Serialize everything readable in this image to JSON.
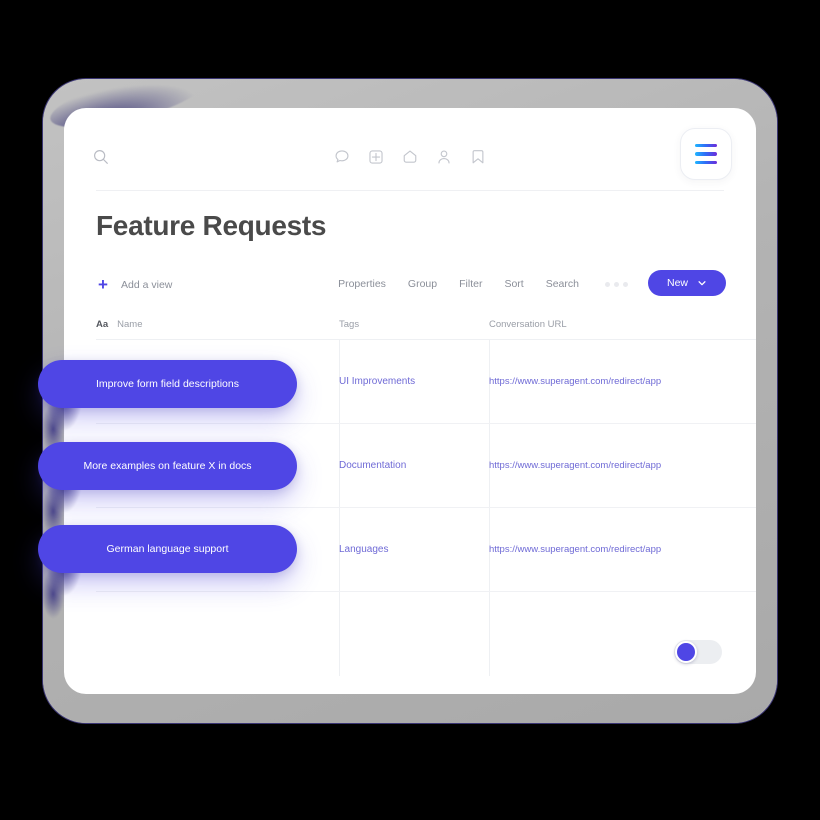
{
  "header": {
    "search_icon": "search-icon",
    "nav_icons": [
      {
        "name": "chat-bubble-icon",
        "label": "Messages"
      },
      {
        "name": "grid-plus-icon",
        "label": "Apps"
      },
      {
        "name": "home-icon",
        "label": "Home"
      },
      {
        "name": "user-icon",
        "label": "Profile"
      },
      {
        "name": "bookmark-icon",
        "label": "Saved"
      }
    ],
    "menu_icon": "hamburger-menu-icon",
    "menu_gradient": [
      "#1fb6ff",
      "#2f6df6",
      "#6d2bd9"
    ]
  },
  "page": {
    "title": "Feature Requests"
  },
  "toolbar": {
    "add_view_label": "Add a view",
    "plus_icon": "plus-icon",
    "links": [
      "Properties",
      "Group",
      "Filter",
      "Sort",
      "Search"
    ],
    "overflow_icon": "more-dots-icon",
    "new_button_label": "New",
    "new_button_chevron": "chevron-down-icon",
    "new_button_color": "#4f46e5"
  },
  "table": {
    "columns": [
      {
        "key": "name",
        "label": "Name",
        "type_badge": "Aa"
      },
      {
        "key": "tags",
        "label": "Tags"
      },
      {
        "key": "url",
        "label": "Conversation URL"
      }
    ],
    "rows": [
      {
        "name": "Improve form field descriptions",
        "tags": "UI Improvements",
        "url": "https://www.superagent.com/redirect/app"
      },
      {
        "name": "More examples on feature X in docs",
        "tags": "Documentation",
        "url": "https://www.superagent.com/redirect/app"
      },
      {
        "name": "German language support",
        "tags": "Languages",
        "url": "https://www.superagent.com/redirect/app"
      }
    ],
    "empty_row_count": 1,
    "pill_color": "#4f46e5",
    "link_color": "#6f6ad6"
  },
  "toggle": {
    "name": "view-toggle",
    "state": "off",
    "knob_color": "#4f46e5",
    "track_color": "#eceef1"
  },
  "frame": {
    "bezel_color": "#b6b6b6",
    "accent_color": "#3a3573",
    "background_color": "#000000"
  }
}
